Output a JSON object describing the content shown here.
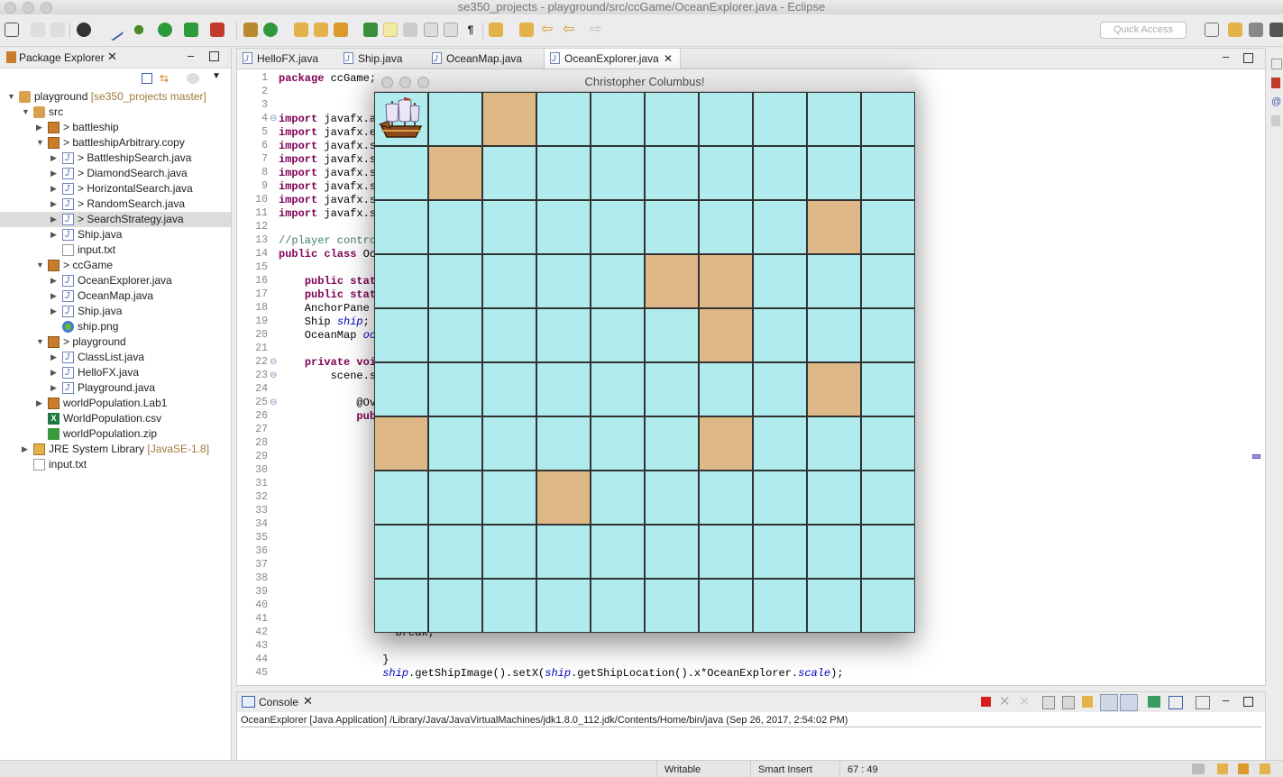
{
  "window": {
    "title": "se350_projects - playground/src/ccGame/OceanExplorer.java - Eclipse"
  },
  "toolbar": {
    "quick_access_placeholder": "Quick Access"
  },
  "package_explorer": {
    "title": "Package Explorer",
    "items": [
      {
        "label": "playground",
        "decoration": "[se350_projects master]",
        "icon": "project-icon",
        "depth": 0,
        "expanded": true
      },
      {
        "label": "src",
        "icon": "package-folder-icon",
        "depth": 1,
        "expanded": true
      },
      {
        "label": "> battleship",
        "icon": "package-icon",
        "depth": 2,
        "expanded": false
      },
      {
        "label": "> battleshipArbitrary.copy",
        "icon": "package-icon",
        "depth": 2,
        "expanded": true
      },
      {
        "label": "> BattleshipSearch.java",
        "icon": "java-file-icon",
        "depth": 3,
        "expanded": false
      },
      {
        "label": "> DiamondSearch.java",
        "icon": "java-file-icon",
        "depth": 3,
        "expanded": false
      },
      {
        "label": "> HorizontalSearch.java",
        "icon": "java-file-icon",
        "depth": 3,
        "expanded": false
      },
      {
        "label": "> RandomSearch.java",
        "icon": "java-file-icon",
        "depth": 3,
        "expanded": false
      },
      {
        "label": "> SearchStrategy.java",
        "icon": "java-file-icon",
        "depth": 3,
        "expanded": false,
        "selected": true
      },
      {
        "label": "Ship.java",
        "icon": "java-file-icon",
        "depth": 3,
        "expanded": false
      },
      {
        "label": "input.txt",
        "icon": "text-file-icon",
        "depth": 3,
        "leaf": true
      },
      {
        "label": "> ccGame",
        "icon": "package-icon",
        "depth": 2,
        "expanded": true
      },
      {
        "label": "OceanExplorer.java",
        "icon": "java-file-icon",
        "depth": 3,
        "expanded": false
      },
      {
        "label": "OceanMap.java",
        "icon": "java-file-icon",
        "depth": 3,
        "expanded": false
      },
      {
        "label": "Ship.java",
        "icon": "java-file-icon",
        "depth": 3,
        "expanded": false
      },
      {
        "label": "ship.png",
        "icon": "image-file-icon",
        "depth": 3,
        "leaf": true
      },
      {
        "label": "> playground",
        "icon": "package-icon",
        "depth": 2,
        "expanded": true
      },
      {
        "label": "ClassList.java",
        "icon": "java-file-icon",
        "depth": 3,
        "expanded": false
      },
      {
        "label": "HelloFX.java",
        "icon": "java-file-icon",
        "depth": 3,
        "expanded": false
      },
      {
        "label": "Playground.java",
        "icon": "java-file-icon",
        "depth": 3,
        "expanded": false
      },
      {
        "label": "worldPopulation.Lab1",
        "icon": "package-icon",
        "depth": 2,
        "expanded": false
      },
      {
        "label": "WorldPopulation.csv",
        "icon": "csv-file-icon",
        "depth": 2,
        "leaf": true
      },
      {
        "label": "worldPopulation.zip",
        "icon": "zip-file-icon",
        "depth": 2,
        "leaf": true
      },
      {
        "label": "JRE System Library",
        "decoration": "[JavaSE-1.8]",
        "icon": "library-icon",
        "depth": 1,
        "expanded": false
      },
      {
        "label": "input.txt",
        "icon": "text-file-icon",
        "depth": 1,
        "leaf": true
      }
    ]
  },
  "editor": {
    "tabs": [
      {
        "label": "HelloFX.java",
        "active": false
      },
      {
        "label": "Ship.java",
        "active": false
      },
      {
        "label": "OceanMap.java",
        "active": false
      },
      {
        "label": "OceanExplorer.java",
        "active": true
      }
    ],
    "line_numbers": [
      "1",
      "2",
      "3",
      "4",
      "5",
      "6",
      "7",
      "8",
      "9",
      "10",
      "11",
      "12",
      "13",
      "14",
      "15",
      "16",
      "17",
      "18",
      "19",
      "20",
      "21",
      "22",
      "23",
      "24",
      "25",
      "26",
      "27",
      "28",
      "29",
      "30",
      "31",
      "32",
      "33",
      "34",
      "35",
      "36",
      "37",
      "38",
      "39",
      "40",
      "41",
      "42",
      "43",
      "44",
      "45"
    ],
    "fold_markers": [
      "4",
      "22",
      "23",
      "25"
    ],
    "code_lines": [
      {
        "n": 1,
        "parts": [
          [
            "kw",
            "package"
          ],
          [
            "",
            "ccGame;"
          ]
        ]
      },
      {
        "n": 4,
        "parts": [
          [
            "kw",
            "import"
          ],
          [
            "",
            "javafx.ap"
          ]
        ]
      },
      {
        "n": 5,
        "parts": [
          [
            "kw",
            "import"
          ],
          [
            "",
            "javafx.ev"
          ]
        ]
      },
      {
        "n": 6,
        "parts": [
          [
            "kw",
            "import"
          ],
          [
            "",
            "javafx.sc"
          ]
        ]
      },
      {
        "n": 7,
        "parts": [
          [
            "kw",
            "import"
          ],
          [
            "",
            "javafx.sc"
          ]
        ]
      },
      {
        "n": 8,
        "parts": [
          [
            "kw",
            "import"
          ],
          [
            "",
            "javafx.sc"
          ]
        ]
      },
      {
        "n": 9,
        "parts": [
          [
            "kw",
            "import"
          ],
          [
            "",
            "javafx.sc"
          ]
        ]
      },
      {
        "n": 10,
        "parts": [
          [
            "kw",
            "import"
          ],
          [
            "",
            "javafx.st"
          ]
        ]
      },
      {
        "n": 11,
        "parts": [
          [
            "kw",
            "import"
          ],
          [
            "",
            "javafx.sc"
          ]
        ]
      },
      {
        "n": 13,
        "parts": [
          [
            "cm",
            "//player control"
          ]
        ]
      },
      {
        "n": 14,
        "parts": [
          [
            "kw",
            "public class"
          ],
          [
            "",
            "Oce"
          ]
        ]
      },
      {
        "n": 16,
        "parts": [
          [
            "",
            "    "
          ],
          [
            "kw",
            "public stati"
          ]
        ]
      },
      {
        "n": 17,
        "parts": [
          [
            "",
            "    "
          ],
          [
            "kw",
            "public stati"
          ]
        ]
      },
      {
        "n": 18,
        "parts": [
          [
            "",
            "    AnchorPane "
          ],
          [
            "fld",
            "r"
          ]
        ]
      },
      {
        "n": 19,
        "parts": [
          [
            "",
            "    Ship "
          ],
          [
            "fld",
            "ship"
          ],
          [
            "",
            ";"
          ]
        ]
      },
      {
        "n": 20,
        "parts": [
          [
            "",
            "    OceanMap "
          ],
          [
            "fld",
            "oce"
          ]
        ]
      },
      {
        "n": 22,
        "parts": [
          [
            "",
            "    "
          ],
          [
            "kw",
            "private void"
          ]
        ]
      },
      {
        "n": 23,
        "parts": [
          [
            "",
            "        scene.se"
          ]
        ]
      },
      {
        "n": 25,
        "parts": [
          [
            "",
            "            @Ove"
          ]
        ]
      },
      {
        "n": 26,
        "parts": [
          [
            "",
            "            "
          ],
          [
            "kw",
            "publ"
          ]
        ]
      },
      {
        "n": 42,
        "parts": [
          [
            "",
            "                  break;"
          ]
        ]
      },
      {
        "n": 44,
        "parts": [
          [
            "",
            "                }"
          ]
        ]
      },
      {
        "n": 45,
        "parts": [
          [
            "",
            "                "
          ],
          [
            "fld",
            "ship"
          ],
          [
            "",
            ".getShipImage().setX("
          ],
          [
            "fld",
            "ship"
          ],
          [
            "",
            ".getShipLocation().x*OceanExplorer."
          ],
          [
            "fld",
            "scale"
          ],
          [
            "",
            ");"
          ]
        ]
      }
    ]
  },
  "game_window": {
    "title": "Christopher Columbus!",
    "grid_size": 10,
    "ship_cell": {
      "row": 0,
      "col": 0
    },
    "islands": [
      {
        "row": 0,
        "col": 2
      },
      {
        "row": 1,
        "col": 1
      },
      {
        "row": 2,
        "col": 8
      },
      {
        "row": 3,
        "col": 5
      },
      {
        "row": 3,
        "col": 6
      },
      {
        "row": 4,
        "col": 6
      },
      {
        "row": 5,
        "col": 8
      },
      {
        "row": 6,
        "col": 0
      },
      {
        "row": 6,
        "col": 6
      },
      {
        "row": 7,
        "col": 3
      }
    ],
    "colors": {
      "water": "#b0eced",
      "island": "#deb887",
      "grid_line": "#333333"
    }
  },
  "console": {
    "title": "Console",
    "output": "OceanExplorer [Java Application] /Library/Java/JavaVirtualMachines/jdk1.8.0_112.jdk/Contents/Home/bin/java (Sep 26, 2017, 2:54:02 PM)"
  },
  "status_bar": {
    "writable": "Writable",
    "insert_mode": "Smart Insert",
    "position": "67 : 49"
  }
}
